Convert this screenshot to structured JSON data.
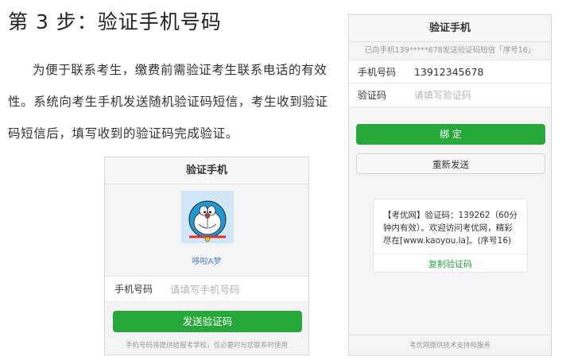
{
  "heading": "第 3 步：验证手机号码",
  "paragraph": "为便于联系考生，缴费前需验证考生联系电话的有效性。系统向考生手机发送随机验证码短信，考生收到验证码短信后，填写收到的验证码完成验证。",
  "left_phone": {
    "title": "验证手机",
    "avatar_name": "哆啦A梦",
    "phone_label": "手机号码",
    "phone_placeholder": "请填写手机号码",
    "send_button": "发送验证码",
    "footnote": "手机号码将提供给报考学校，仅必要时与您联系时使用"
  },
  "right_phone": {
    "title": "验证手机",
    "notice": "已向手机139*****678发送验证码短信「序号16」",
    "phone_label": "手机号码",
    "phone_value": "13912345678",
    "code_label": "验证码",
    "code_placeholder": "请填写验证码",
    "bind_button": "绑 定",
    "resend_button": "重新发送",
    "sms_text": "【考优网】验证码：139262（60分钟内有效）。欢迎访问考优网，精彩尽在[www.kaoyou.la]。(序号16)",
    "copy_code": "复制验证码",
    "footer": "考优网提供技术支持和服务"
  },
  "colors": {
    "accent_green": "#26a83a",
    "link_blue": "#4d7cc8"
  },
  "icons": {
    "avatar": "doraemon-avatar-icon"
  }
}
